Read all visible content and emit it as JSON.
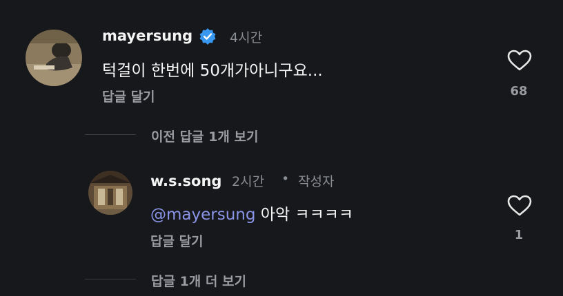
{
  "comment1": {
    "username": "mayersung",
    "time": "4시간",
    "text": "턱걸이 한번에 50개가아니구요...",
    "reply_label": "답글 달기",
    "likes": "68"
  },
  "view_previous": "이전 답글 1개 보기",
  "comment2": {
    "username": "w.s.song",
    "time": "2시간",
    "separator": "•",
    "author_tag": "작성자",
    "mention": "@mayersung",
    "text": " 아악 ㅋㅋㅋㅋ",
    "reply_label": "답글 달기",
    "likes": "1"
  },
  "view_more": "답글 1개 더 보기",
  "colors": {
    "background": "#17181b",
    "mention": "#8a95e8",
    "verified": "#3897f0"
  }
}
